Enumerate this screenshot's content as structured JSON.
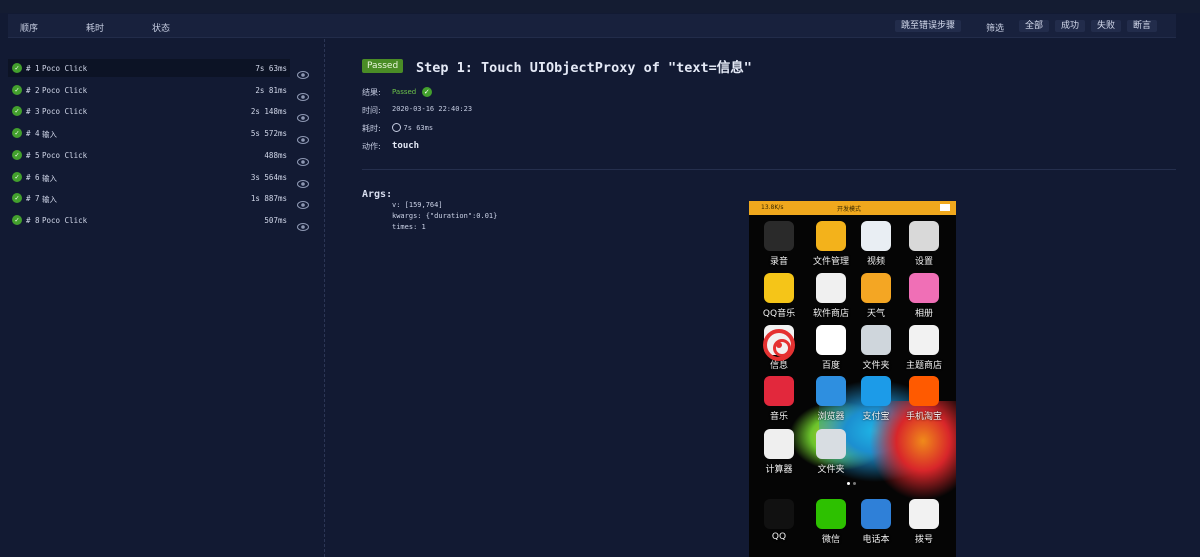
{
  "toolbar": {
    "col_order": "顺序",
    "col_time": "耗时",
    "col_status": "状态",
    "jump_error": "跳至错误步骤",
    "filter_label": "筛选",
    "filter_all": "全部",
    "filter_success": "成功",
    "filter_fail": "失败",
    "filter_assert": "断言"
  },
  "steps": [
    {
      "num": "# 1",
      "name": "Poco Click",
      "duration": "7s 63ms"
    },
    {
      "num": "# 2",
      "name": "Poco Click",
      "duration": "2s 81ms"
    },
    {
      "num": "# 3",
      "name": "Poco Click",
      "duration": "2s 148ms"
    },
    {
      "num": "# 4",
      "name": "输入",
      "duration": "5s 572ms"
    },
    {
      "num": "# 5",
      "name": "Poco Click",
      "duration": "488ms"
    },
    {
      "num": "# 6",
      "name": "输入",
      "duration": "3s 564ms"
    },
    {
      "num": "# 7",
      "name": "输入",
      "duration": "1s 887ms"
    },
    {
      "num": "# 8",
      "name": "Poco Click",
      "duration": "507ms"
    }
  ],
  "detail": {
    "badge": "Passed",
    "title": "Step 1: Touch UIObjectProxy of \"text=信息\"",
    "result_label": "结果:",
    "result_value": "Passed",
    "time_label": "时间:",
    "time_value": "2020-03-16 22:40:23",
    "duration_label": "耗时:",
    "duration_value": "7s 63ms",
    "action_label": "动作:",
    "action_value": "touch",
    "args_title": "Args:",
    "args": [
      "v: [159,764]",
      "kwargs: {\"duration\":0.01}",
      "times: 1"
    ]
  },
  "phone": {
    "status_left": "13.8K/s",
    "status_center": "开发模式",
    "apps": [
      {
        "label": "录音",
        "icon": "recorder-icon",
        "color": "#2a2a2a"
      },
      {
        "label": "文件管理",
        "icon": "file-manager-icon",
        "color": "#f3b21b"
      },
      {
        "label": "视频",
        "icon": "video-icon",
        "color": "#e9eef3"
      },
      {
        "label": "设置",
        "icon": "settings-icon",
        "color": "#d9d9d9"
      },
      {
        "label": "QQ音乐",
        "icon": "qq-music-icon",
        "color": "#f5c518"
      },
      {
        "label": "软件商店",
        "icon": "app-store-icon",
        "color": "#f0f0f0"
      },
      {
        "label": "天气",
        "icon": "weather-icon",
        "color": "#f4a623"
      },
      {
        "label": "相册",
        "icon": "gallery-icon",
        "color": "#f06fb6"
      },
      {
        "label": "信息",
        "icon": "messages-icon",
        "color": "#f2f2f2"
      },
      {
        "label": "百度",
        "icon": "baidu-icon",
        "color": "#ffffff"
      },
      {
        "label": "文件夹",
        "icon": "folder-icon",
        "color": "#cfd6dc"
      },
      {
        "label": "主题商店",
        "icon": "theme-store-icon",
        "color": "#f2f2f2"
      },
      {
        "label": "音乐",
        "icon": "music-icon",
        "color": "#e2283c"
      },
      {
        "label": "浏览器",
        "icon": "browser-icon",
        "color": "#2e8fe0"
      },
      {
        "label": "支付宝",
        "icon": "alipay-icon",
        "color": "#1c9be8"
      },
      {
        "label": "手机淘宝",
        "icon": "taobao-icon",
        "color": "#ff5a00"
      },
      {
        "label": "计算器",
        "icon": "calculator-icon",
        "color": "#efefef"
      },
      {
        "label": "文件夹",
        "icon": "folder-icon",
        "color": "#d8dde2"
      },
      {
        "label": "QQ",
        "icon": "qq-icon",
        "color": "#111111"
      },
      {
        "label": "微信",
        "icon": "wechat-icon",
        "color": "#2dc100"
      },
      {
        "label": "电话本",
        "icon": "contacts-icon",
        "color": "#2f80d8"
      },
      {
        "label": "拨号",
        "icon": "dialer-icon",
        "color": "#f2f2f2"
      }
    ]
  }
}
